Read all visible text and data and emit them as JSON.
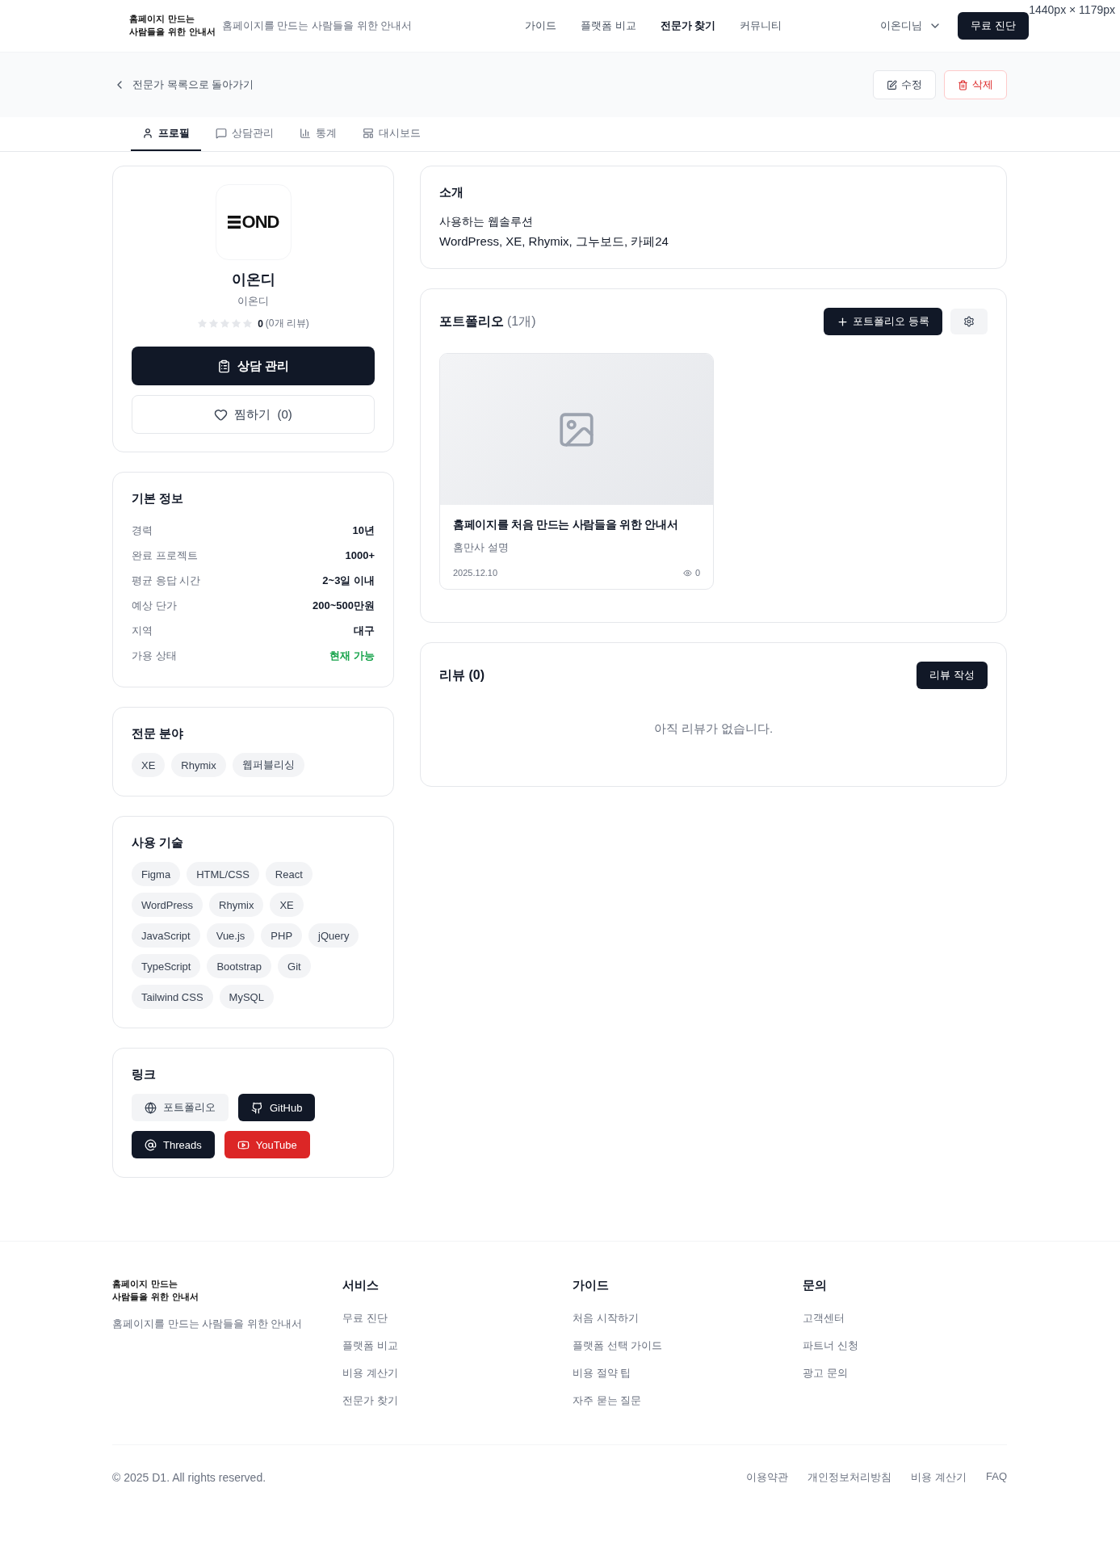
{
  "size_label": "1440px × 1179px",
  "header": {
    "logo_lines": [
      "홈페이지 만드는",
      "사람들을 위한 안내서"
    ],
    "tagline": "홈페이지를 만드는 사람들을 위한 안내서",
    "nav": [
      {
        "label": "가이드",
        "selected": false
      },
      {
        "label": "플랫폼 비교",
        "selected": false
      },
      {
        "label": "전문가 찾기",
        "selected": true
      },
      {
        "label": "커뮤니티",
        "selected": false
      }
    ],
    "user": "이온디님",
    "cta": "무료 진단"
  },
  "subbar": {
    "back": "전문가 목록으로 돌아가기",
    "edit": "수정",
    "delete": "삭제"
  },
  "tabs": [
    {
      "label": "프로필",
      "kind": "profile",
      "selected": true
    },
    {
      "label": "상담관리",
      "kind": "consult",
      "selected": false
    },
    {
      "label": "통계",
      "kind": "stats",
      "selected": false
    },
    {
      "label": "대시보드",
      "kind": "dashboard",
      "selected": false
    }
  ],
  "profile": {
    "logo_text": "OND",
    "name": "이온디",
    "company": "이온디",
    "stars": 0,
    "rating": "0",
    "review_count": "(0개 리뷰)",
    "primary_button": "상담 관리",
    "like_button": "찜하기  (0)"
  },
  "basic_info": {
    "title": "기본 정보",
    "rows": [
      {
        "label": "경력",
        "value": "10년",
        "kind": "plain"
      },
      {
        "label": "완료 프로젝트",
        "value": "1000+",
        "kind": "plain"
      },
      {
        "label": "평균 응답 시간",
        "value": "2~3일 이내",
        "kind": "plain"
      },
      {
        "label": "예상 단가",
        "value": "200~500만원",
        "kind": "plain"
      },
      {
        "label": "지역",
        "value": "대구",
        "kind": "plain"
      },
      {
        "label": "가용 상태",
        "value": "현재 가능",
        "kind": "status"
      }
    ]
  },
  "specialties": {
    "title": "전문 분야",
    "tags": [
      "XE",
      "Rhymix",
      "웹퍼블리싱"
    ]
  },
  "skills": {
    "title": "사용 기술",
    "tags": [
      "Figma",
      "HTML/CSS",
      "React",
      "WordPress",
      "Rhymix",
      "XE",
      "JavaScript",
      "Vue.js",
      "PHP",
      "jQuery",
      "TypeScript",
      "Bootstrap",
      "Git",
      "Tailwind CSS",
      "MySQL"
    ]
  },
  "links": {
    "title": "링크",
    "items": [
      {
        "label": "포트폴리오",
        "kind": "website"
      },
      {
        "label": "GitHub",
        "kind": "github"
      },
      {
        "label": "Threads",
        "kind": "threads"
      },
      {
        "label": "YouTube",
        "kind": "youtube"
      }
    ]
  },
  "intro": {
    "title": "소개",
    "lines": [
      "사용하는 웹솔루션",
      "WordPress, XE, Rhymix, 그누보드, 카페24"
    ]
  },
  "portfolio": {
    "title": "포트폴리오",
    "count": "(1개)",
    "add_button": "포트폴리오 등록",
    "items": [
      {
        "kind": "picture",
        "title": "홈페이지를 처음 만드는 사람들을 위한 안내서",
        "description": "홈만사 설명",
        "date": "2025.12.10",
        "views": "0"
      }
    ]
  },
  "reviews": {
    "title": "리뷰 (0)",
    "write_button": "리뷰 작성",
    "empty": "아직 리뷰가 없습니다."
  },
  "footer": {
    "logo_lines": [
      "홈페이지 만드는",
      "사람들을 위한 안내서"
    ],
    "tagline": "홈페이지를 만드는 사람들을 위한 안내서",
    "columns": [
      {
        "title": "서비스",
        "links": [
          "무료 진단",
          "플랫폼 비교",
          "비용 계산기",
          "전문가 찾기"
        ]
      },
      {
        "title": "가이드",
        "links": [
          "처음 시작하기",
          "플랫폼 선택 가이드",
          "비용 절약 팁",
          "자주 묻는 질문"
        ]
      },
      {
        "title": "문의",
        "links": [
          "고객센터",
          "파트너 신청",
          "광고 문의"
        ]
      }
    ],
    "copyright": "© 2025 D1. All rights reserved.",
    "bottom_links": [
      "이용약관",
      "개인정보처리방침",
      "비용 계산기",
      "FAQ"
    ]
  }
}
